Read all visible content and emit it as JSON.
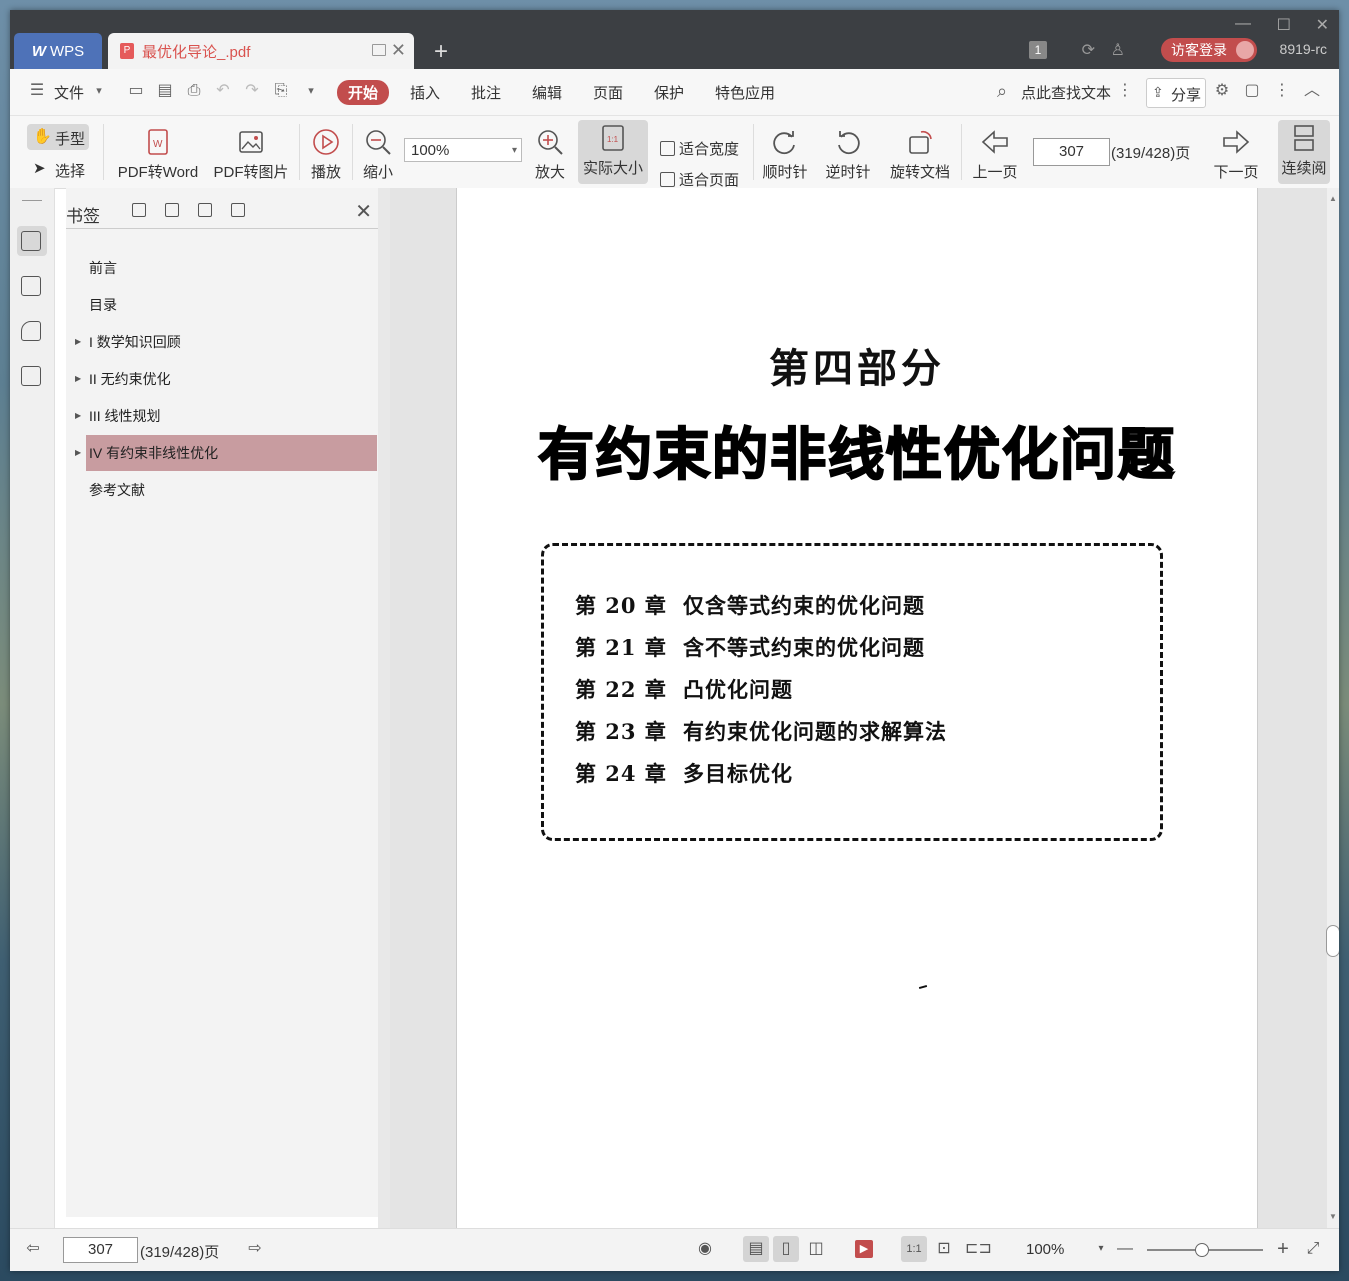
{
  "titlebar": {
    "wps_tab": "WPS",
    "doc_tab": "最优化导论_.pdf",
    "badge": "1",
    "login": "访客登录",
    "user": "8919-rc"
  },
  "menu": {
    "file": "文件",
    "tabs": [
      "开始",
      "插入",
      "批注",
      "编辑",
      "页面",
      "保护",
      "特色应用"
    ],
    "search": "点此查找文本",
    "share": "分享"
  },
  "toolbar": {
    "hand": "手型",
    "select": "选择",
    "pdf_word": "PDF转Word",
    "pdf_img": "PDF转图片",
    "play": "播放",
    "zoom_out": "缩小",
    "zoom_value": "100%",
    "zoom_in": "放大",
    "actual_size": "实际大小",
    "fit_width": "适合宽度",
    "fit_page": "适合页面",
    "clockwise": "顺时针",
    "counter": "逆时针",
    "rotate": "旋转文档",
    "prev": "上一页",
    "page": "307",
    "page_info": "(319/428)页",
    "next": "下一页",
    "continuous": "连续阅"
  },
  "bookmarks": {
    "title": "书签",
    "items": [
      {
        "label": "前言",
        "arrow": ""
      },
      {
        "label": "目录",
        "arrow": ""
      },
      {
        "label": "I 数学知识回顾",
        "arrow": "▶"
      },
      {
        "label": "II 无约束优化",
        "arrow": "▶"
      },
      {
        "label": "III 线性规划",
        "arrow": "▶"
      },
      {
        "label": "IV  有约束非线性优化",
        "arrow": "▶"
      },
      {
        "label": "参考文献",
        "arrow": ""
      }
    ]
  },
  "document": {
    "part": "第四部分",
    "title": "有约束的非线性优化问题",
    "chapters": [
      {
        "num": "第 20 章",
        "name": "仅含等式约束的优化问题"
      },
      {
        "num": "第 21 章",
        "name": "含不等式约束的优化问题"
      },
      {
        "num": "第 22 章",
        "name": "凸优化问题"
      },
      {
        "num": "第 23 章",
        "name": "有约束优化问题的求解算法"
      },
      {
        "num": "第 24 章",
        "name": "多目标优化"
      }
    ]
  },
  "status": {
    "page": "307",
    "page_info": "(319/428)页",
    "zoom": "100%"
  },
  "colors": {
    "accent": "#c24d4d",
    "selected_bookmark": "#c89ca0",
    "titlebar": "#3c3f43"
  }
}
